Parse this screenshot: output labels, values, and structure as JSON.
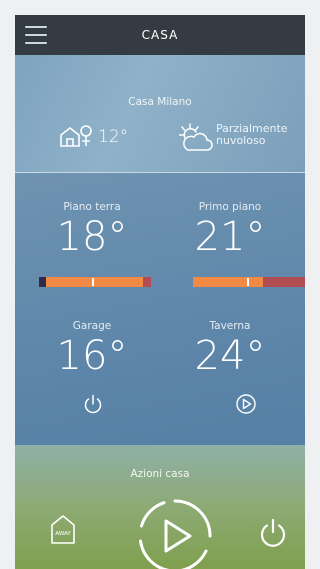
{
  "header": {
    "title": "CASA",
    "menu_icon": "hamburger-menu-icon"
  },
  "weather": {
    "city": "Casa Milano",
    "outside_temp": "12°",
    "condition_line1": "Parzialmente",
    "condition_line2": "nuvoloso",
    "icons": [
      "home-temperature-icon",
      "partly-cloudy-icon"
    ]
  },
  "zones": [
    {
      "name": "Piano terra",
      "temp": "18°",
      "bar_level": 0.48
    },
    {
      "name": "Primo piano",
      "temp": "21°",
      "bar_level": 0.56
    },
    {
      "name": "Garage",
      "temp": "16°",
      "control_icon": "power-icon"
    },
    {
      "name": "Taverna",
      "temp": "24°",
      "control_icon": "play-icon"
    }
  ],
  "actions": {
    "label": "Azioni casa",
    "away_label": "AWAY",
    "icons": [
      "away-home-icon",
      "play-icon",
      "power-icon"
    ]
  },
  "colors": {
    "topbar": "#353b42",
    "bar_orange": "#f08a45",
    "bar_red": "#b14c52",
    "bar_dark": "#2d2a4a"
  }
}
